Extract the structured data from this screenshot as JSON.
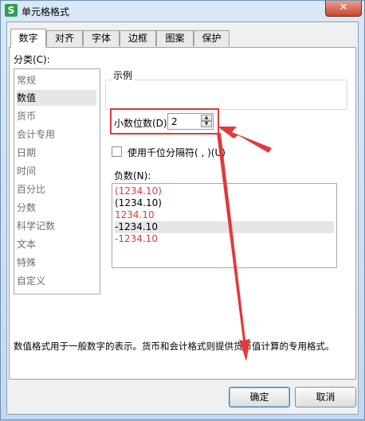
{
  "window": {
    "title": "单元格格式",
    "app_icon_text": "S",
    "close_symbol": "✕"
  },
  "tabs": [
    {
      "label": "数字",
      "active": true
    },
    {
      "label": "对齐"
    },
    {
      "label": "字体"
    },
    {
      "label": "边框"
    },
    {
      "label": "图案"
    },
    {
      "label": "保护"
    }
  ],
  "category": {
    "label": "分类(C):",
    "items": [
      "常规",
      "数值",
      "货币",
      "会计专用",
      "日期",
      "时间",
      "百分比",
      "分数",
      "科学记数",
      "文本",
      "特殊",
      "自定义"
    ],
    "selected": "数值"
  },
  "sample": {
    "label": "示例"
  },
  "decimals": {
    "label": "小数位数(D):",
    "value": "2"
  },
  "thousands": {
    "label": "使用千位分隔符( , )(U)",
    "checked": false
  },
  "negative": {
    "label": "负数(N):",
    "items": [
      {
        "text": "(1234.10)",
        "color": "#e03a3a"
      },
      {
        "text": "(1234.10)",
        "color": "#000000"
      },
      {
        "text": "1234.10",
        "color": "#e03a3a"
      },
      {
        "text": "-1234.10",
        "color": "#000000",
        "selected": true
      },
      {
        "text": "-1234.10",
        "color": "#e03a3a"
      }
    ]
  },
  "description": "数值格式用于一般数字的表示。货币和会计格式则提供货币值计算的专用格式。",
  "buttons": {
    "ok": "确定",
    "cancel": "取消"
  },
  "colors": {
    "annotation_red": "#e03a3a",
    "input_border": "#7a9cc6"
  }
}
